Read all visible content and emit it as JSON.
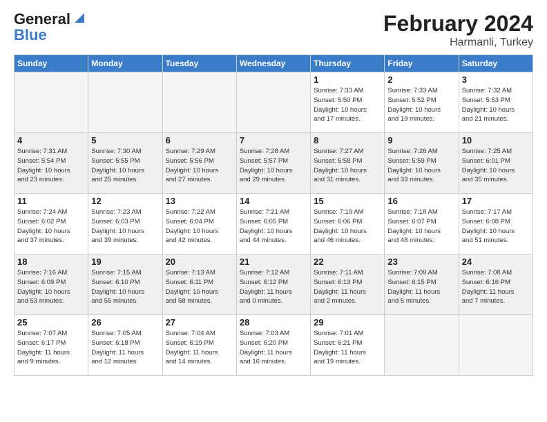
{
  "logo": {
    "line1": "General",
    "line2": "Blue"
  },
  "header": {
    "title": "February 2024",
    "subtitle": "Harmanli, Turkey"
  },
  "days_of_week": [
    "Sunday",
    "Monday",
    "Tuesday",
    "Wednesday",
    "Thursday",
    "Friday",
    "Saturday"
  ],
  "weeks": [
    {
      "days": [
        {
          "date": "",
          "info": ""
        },
        {
          "date": "",
          "info": ""
        },
        {
          "date": "",
          "info": ""
        },
        {
          "date": "",
          "info": ""
        },
        {
          "date": "1",
          "info": "Sunrise: 7:33 AM\nSunset: 5:50 PM\nDaylight: 10 hours\nand 17 minutes."
        },
        {
          "date": "2",
          "info": "Sunrise: 7:33 AM\nSunset: 5:52 PM\nDaylight: 10 hours\nand 19 minutes."
        },
        {
          "date": "3",
          "info": "Sunrise: 7:32 AM\nSunset: 5:53 PM\nDaylight: 10 hours\nand 21 minutes."
        }
      ]
    },
    {
      "days": [
        {
          "date": "4",
          "info": "Sunrise: 7:31 AM\nSunset: 5:54 PM\nDaylight: 10 hours\nand 23 minutes."
        },
        {
          "date": "5",
          "info": "Sunrise: 7:30 AM\nSunset: 5:55 PM\nDaylight: 10 hours\nand 25 minutes."
        },
        {
          "date": "6",
          "info": "Sunrise: 7:29 AM\nSunset: 5:56 PM\nDaylight: 10 hours\nand 27 minutes."
        },
        {
          "date": "7",
          "info": "Sunrise: 7:28 AM\nSunset: 5:57 PM\nDaylight: 10 hours\nand 29 minutes."
        },
        {
          "date": "8",
          "info": "Sunrise: 7:27 AM\nSunset: 5:58 PM\nDaylight: 10 hours\nand 31 minutes."
        },
        {
          "date": "9",
          "info": "Sunrise: 7:26 AM\nSunset: 5:59 PM\nDaylight: 10 hours\nand 33 minutes."
        },
        {
          "date": "10",
          "info": "Sunrise: 7:25 AM\nSunset: 6:01 PM\nDaylight: 10 hours\nand 35 minutes."
        }
      ]
    },
    {
      "days": [
        {
          "date": "11",
          "info": "Sunrise: 7:24 AM\nSunset: 6:02 PM\nDaylight: 10 hours\nand 37 minutes."
        },
        {
          "date": "12",
          "info": "Sunrise: 7:23 AM\nSunset: 6:03 PM\nDaylight: 10 hours\nand 39 minutes."
        },
        {
          "date": "13",
          "info": "Sunrise: 7:22 AM\nSunset: 6:04 PM\nDaylight: 10 hours\nand 42 minutes."
        },
        {
          "date": "14",
          "info": "Sunrise: 7:21 AM\nSunset: 6:05 PM\nDaylight: 10 hours\nand 44 minutes."
        },
        {
          "date": "15",
          "info": "Sunrise: 7:19 AM\nSunset: 6:06 PM\nDaylight: 10 hours\nand 46 minutes."
        },
        {
          "date": "16",
          "info": "Sunrise: 7:18 AM\nSunset: 6:07 PM\nDaylight: 10 hours\nand 48 minutes."
        },
        {
          "date": "17",
          "info": "Sunrise: 7:17 AM\nSunset: 6:08 PM\nDaylight: 10 hours\nand 51 minutes."
        }
      ]
    },
    {
      "days": [
        {
          "date": "18",
          "info": "Sunrise: 7:16 AM\nSunset: 6:09 PM\nDaylight: 10 hours\nand 53 minutes."
        },
        {
          "date": "19",
          "info": "Sunrise: 7:15 AM\nSunset: 6:10 PM\nDaylight: 10 hours\nand 55 minutes."
        },
        {
          "date": "20",
          "info": "Sunrise: 7:13 AM\nSunset: 6:11 PM\nDaylight: 10 hours\nand 58 minutes."
        },
        {
          "date": "21",
          "info": "Sunrise: 7:12 AM\nSunset: 6:12 PM\nDaylight: 11 hours\nand 0 minutes."
        },
        {
          "date": "22",
          "info": "Sunrise: 7:11 AM\nSunset: 6:13 PM\nDaylight: 11 hours\nand 2 minutes."
        },
        {
          "date": "23",
          "info": "Sunrise: 7:09 AM\nSunset: 6:15 PM\nDaylight: 11 hours\nand 5 minutes."
        },
        {
          "date": "24",
          "info": "Sunrise: 7:08 AM\nSunset: 6:16 PM\nDaylight: 11 hours\nand 7 minutes."
        }
      ]
    },
    {
      "days": [
        {
          "date": "25",
          "info": "Sunrise: 7:07 AM\nSunset: 6:17 PM\nDaylight: 11 hours\nand 9 minutes."
        },
        {
          "date": "26",
          "info": "Sunrise: 7:05 AM\nSunset: 6:18 PM\nDaylight: 11 hours\nand 12 minutes."
        },
        {
          "date": "27",
          "info": "Sunrise: 7:04 AM\nSunset: 6:19 PM\nDaylight: 11 hours\nand 14 minutes."
        },
        {
          "date": "28",
          "info": "Sunrise: 7:03 AM\nSunset: 6:20 PM\nDaylight: 11 hours\nand 16 minutes."
        },
        {
          "date": "29",
          "info": "Sunrise: 7:01 AM\nSunset: 6:21 PM\nDaylight: 11 hours\nand 19 minutes."
        },
        {
          "date": "",
          "info": ""
        },
        {
          "date": "",
          "info": ""
        }
      ]
    }
  ]
}
